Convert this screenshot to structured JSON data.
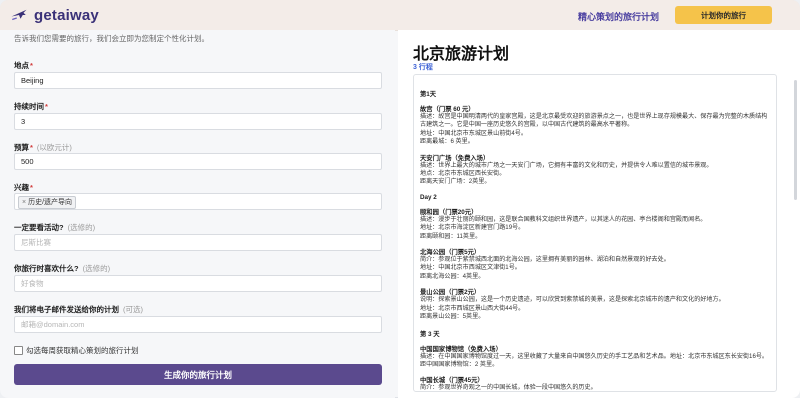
{
  "header": {
    "brand": "getaiway",
    "tagline": "精心策划的旅行计划",
    "cta_label": "计划你的旅行"
  },
  "form": {
    "intro": "告诉我们您需要的旅行，我们会立即为您制定个性化计划。",
    "location": {
      "label": "地点",
      "value": "Beijing"
    },
    "duration": {
      "label": "持续时间",
      "value": "3"
    },
    "budget": {
      "label": "预算",
      "hint": "(以欧元计)",
      "value": "500"
    },
    "interests": {
      "label": "兴趣",
      "chip": "历史/遗产导向"
    },
    "activities": {
      "label": "一定要看活动?",
      "hint": "(选修的)",
      "placeholder": "尼斯比赛"
    },
    "dislikes": {
      "label": "你旅行时喜欢什么?",
      "hint": "(选修的)",
      "placeholder": "好食物"
    },
    "email": {
      "label": "我们将电子邮件发送给你的计划",
      "hint": "(可选)",
      "placeholder": "邮箱@domain.com"
    },
    "subscribe_label": "勾选每周获取精心策划的旅行计划",
    "submit_label": "生成你的旅行计划"
  },
  "plan": {
    "title": "北京旅游计划",
    "count_label": "3 行程",
    "days": [
      {
        "day_label": "第1天",
        "spots": [
          {
            "name": "故宫（门票 60 元）",
            "desc": "描述：故宫是中国明清两代的皇家宫殿，这是北京最受欢迎的旅游景点之一，也是世界上现存规模最大、保存最为完整的木质结构古建筑之一。它是中国一座历史悠久的宫殿，以中国古代建筑的最高水平著称。",
            "addr": "地址：中国北京市东城区景山前街4号。",
            "dist": "距离最城：6 英里。"
          },
          {
            "name": "天安门广场（免费入场）",
            "desc": "描述：世界上最大的城市广场之一天安门广场，它拥有丰富的文化和历史，并提供令人难以置信的城市景观。",
            "addr": "地点：北京市东城区西长安街。",
            "dist": "距离天安门广场：2英里。"
          }
        ]
      },
      {
        "day_label": "Day 2",
        "spots": [
          {
            "name": "颐和园（门票20元）",
            "desc": "描述：漫步于壮丽的颐和园，这是联合国教科文组织世界遗产，以其迷人的花园、亭台楼阁和宫殿而闻名。",
            "addr": "地址：北京市海淀区新建宫门路19号。",
            "dist": "距离颐和园：11英里。"
          },
          {
            "name": "北海公园（门票5元）",
            "desc": "简介：参观位于紫禁城西北面的北海公园，这里拥有美丽的园林、湖泊和自然景观的好去处。",
            "addr": "地址：中国北京市西城区文津街1号。",
            "dist": "距离北海公园：4英里。"
          },
          {
            "name": "景山公园（门票2元）",
            "desc": "说明：探索景山公园，这是一个历史遗迹，可以欣赏到紫禁城的美景，这是探索北京城市的遗产和文化的好地方。",
            "addr": "地址：北京市西城区景山西大街44号。",
            "dist": "距离景山公园：5英里。"
          }
        ]
      },
      {
        "day_label": "第 3 天",
        "spots": [
          {
            "name": "中国国家博物馆（免费入场）",
            "desc": "描述：在中国国家博物馆度过一天，这里收藏了大量来自中国悠久历史的手工艺品和艺术品。地址：北京市东城区东长安街16号。",
            "addr": "",
            "dist": "距中国国家博物馆：2 英里。"
          },
          {
            "name": "中国长城（门票45元）",
            "desc": "简介：参观世界奇观之一的中国长城，体验一段中国悠久的历史。",
            "addr": "地址：北京市延庆区八达岭镇。",
            "dist": "距离中国长城：32 英里。"
          }
        ]
      }
    ]
  },
  "colors": {
    "brand": "#3a3178",
    "cta": "#f5c34a",
    "submit": "#5b4a8e",
    "link": "#3e63d6"
  }
}
